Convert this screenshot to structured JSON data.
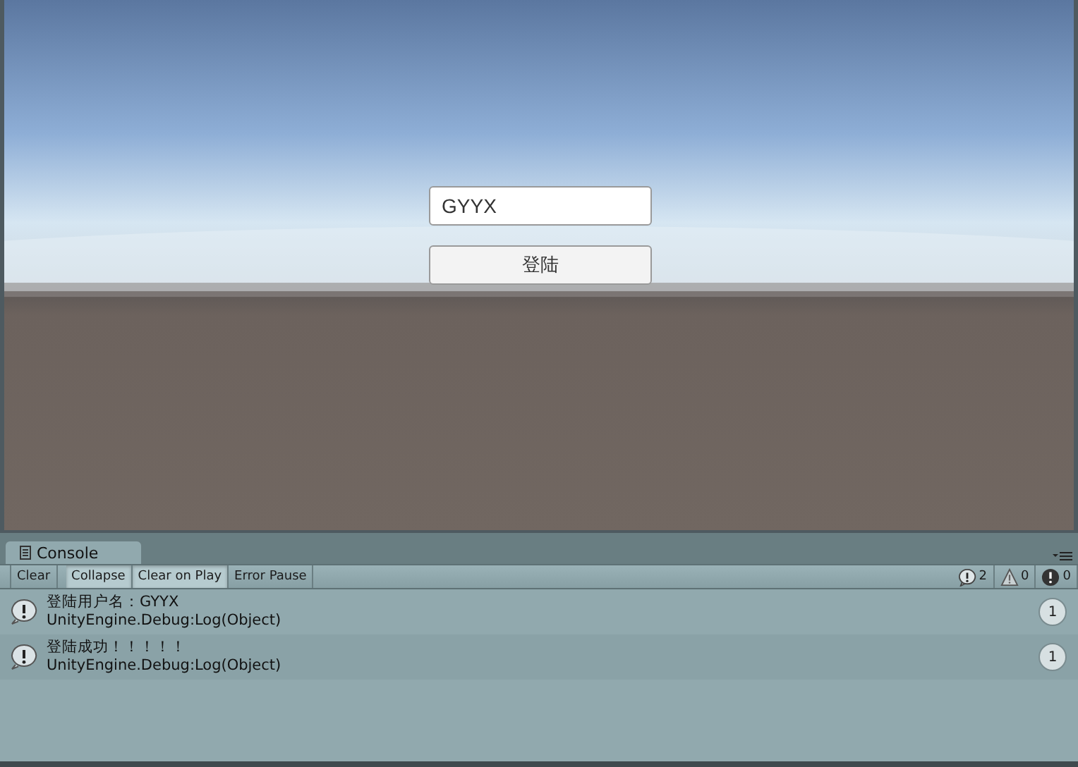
{
  "game_view": {
    "input": {
      "value": "GYYX"
    },
    "button": {
      "label": "登陆"
    }
  },
  "console": {
    "tab": {
      "label": "Console"
    },
    "toolbar": [
      {
        "label": "Clear",
        "selected": false
      },
      {
        "label": "Collapse",
        "selected": true
      },
      {
        "label": "Clear on Play",
        "selected": true
      },
      {
        "label": "Error Pause",
        "selected": false
      }
    ],
    "counters": [
      {
        "kind": "info",
        "count": "2"
      },
      {
        "kind": "warning",
        "count": "0"
      },
      {
        "kind": "error",
        "count": "0"
      }
    ],
    "entries": [
      {
        "message": "登陆用户名：GYYX",
        "trace": "UnityEngine.Debug:Log(Object)",
        "count": "1"
      },
      {
        "message": "登陆成功！！！！！",
        "trace": "UnityEngine.Debug:Log(Object)",
        "count": "1"
      }
    ]
  }
}
